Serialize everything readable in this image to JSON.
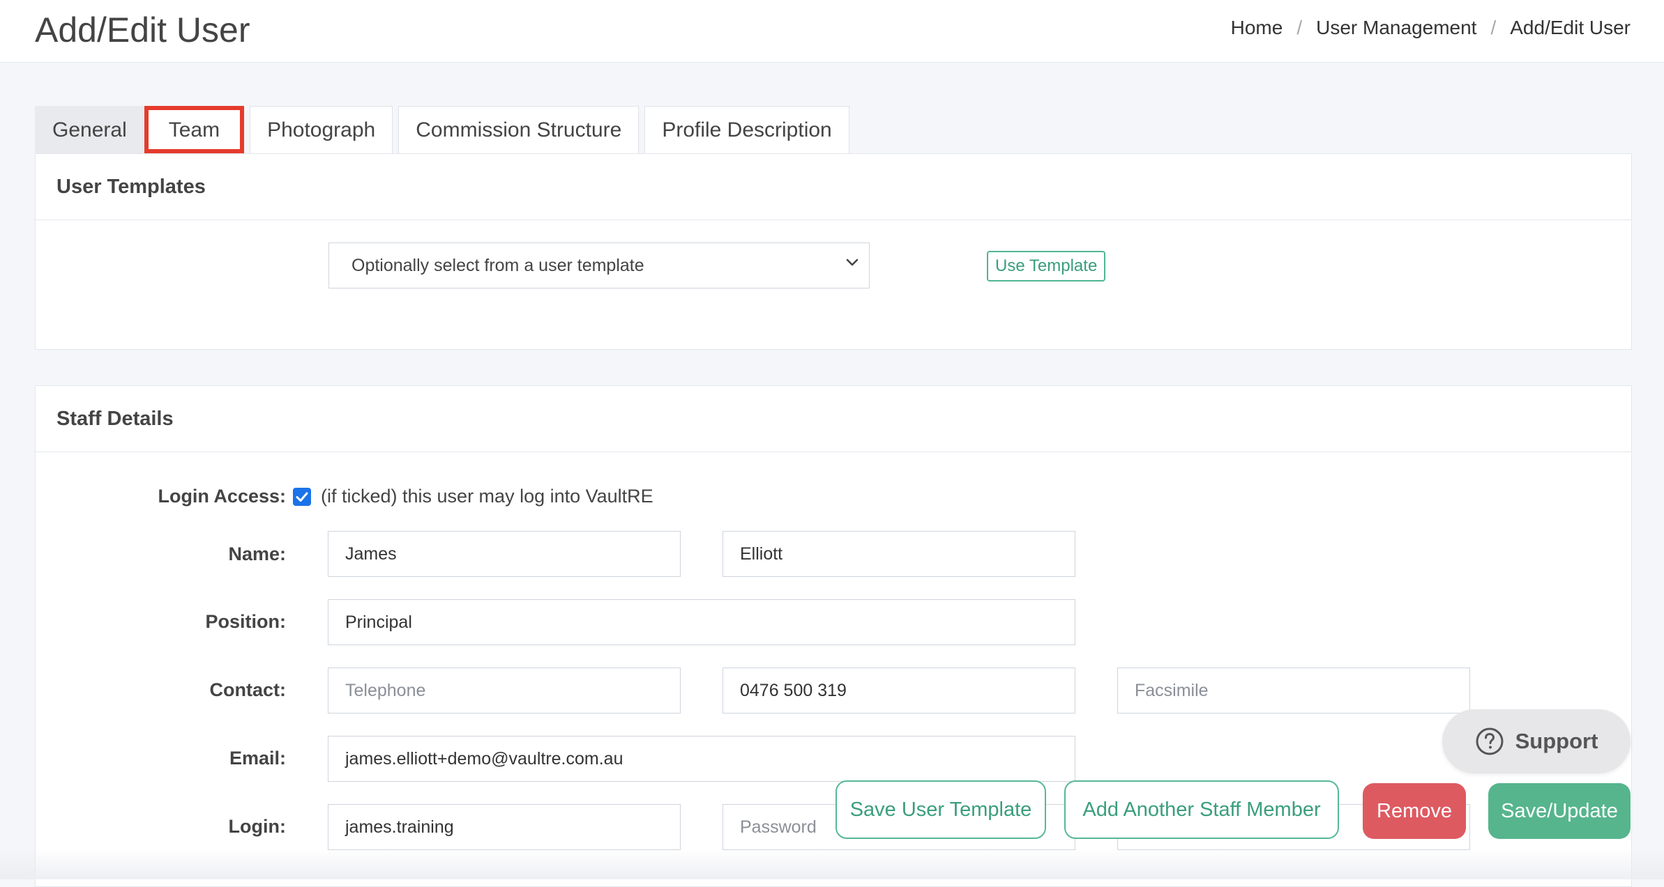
{
  "header": {
    "title": "Add/Edit User",
    "breadcrumb": [
      "Home",
      "User Management",
      "Add/Edit User"
    ]
  },
  "tabs": [
    {
      "label": "General"
    },
    {
      "label": "Team"
    },
    {
      "label": "Photograph"
    },
    {
      "label": "Commission Structure"
    },
    {
      "label": "Profile Description"
    }
  ],
  "templates": {
    "title": "User Templates",
    "select_value": "Optionally select from a user template",
    "use_button": "Use Template"
  },
  "staff": {
    "title": "Staff Details",
    "login_access": {
      "label": "Login Access:",
      "text": "(if ticked) this user may log into VaultRE",
      "checked": true
    },
    "name": {
      "label": "Name:",
      "first": "James",
      "last": "Elliott"
    },
    "position": {
      "label": "Position:",
      "value": "Principal"
    },
    "contact": {
      "label": "Contact:",
      "telephone_placeholder": "Telephone",
      "mobile": "0476 500 319",
      "fax_placeholder": "Facsimile"
    },
    "email": {
      "label": "Email:",
      "value": "james.elliott+demo@vaultre.com.au"
    },
    "login": {
      "label": "Login:",
      "value": "james.training",
      "password_placeholder": "Password"
    }
  },
  "support": {
    "label": "Support"
  },
  "actions": {
    "save_template": "Save User Template",
    "add_another": "Add Another Staff Member",
    "remove": "Remove",
    "save_update": "Save/Update"
  },
  "colors": {
    "accent_green": "#56b58d",
    "danger_red": "#de5a61",
    "highlight": "#e53b2c"
  }
}
